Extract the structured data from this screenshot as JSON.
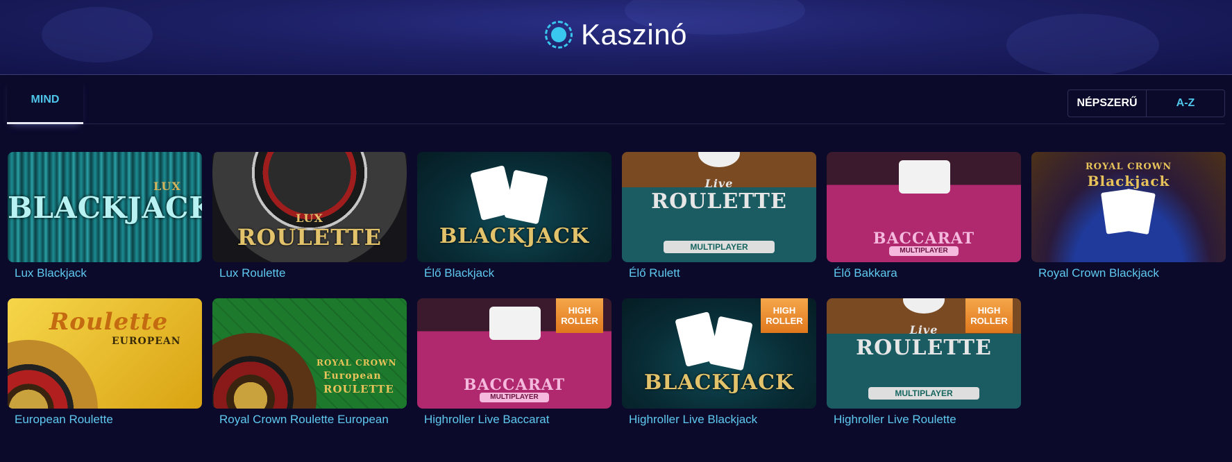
{
  "header": {
    "title": "Kaszinó",
    "icon": "casino-chip-icon"
  },
  "tabs": {
    "all_label": "MIND"
  },
  "sort": {
    "popular_label": "NÉPSZERŰ",
    "az_label": "A-Z"
  },
  "games": [
    {
      "label": "Lux Blackjack",
      "art": "BLACKJACK",
      "art2": "LUX"
    },
    {
      "label": "Lux Roulette",
      "art": "ROULETTE",
      "art2": "LUX"
    },
    {
      "label": "Élő Blackjack",
      "art": "BLACKJACK"
    },
    {
      "label": "Élő Rulett",
      "art": "ROULETTE",
      "art2": "Live",
      "plaque": "MULTIPLAYER"
    },
    {
      "label": "Élő Bakkara",
      "art": "BACCARAT",
      "plaque": "MULTIPLAYER"
    },
    {
      "label": "Royal Crown Blackjack",
      "art": "Blackjack",
      "art2": "ROYAL CROWN"
    },
    {
      "label": "European Roulette",
      "art": "Roulette",
      "art2": "EUROPEAN"
    },
    {
      "label": "Royal Crown Roulette European",
      "art": "ROULETTE",
      "art2": "ROYAL CROWN",
      "art3": "European"
    },
    {
      "label": "Highroller Live Baccarat",
      "art": "BACCARAT",
      "plaque": "MULTIPLAYER",
      "badge1": "HIGH",
      "badge2": "ROLLER"
    },
    {
      "label": "Highroller Live Blackjack",
      "art": "BLACKJACK",
      "badge1": "HIGH",
      "badge2": "ROLLER"
    },
    {
      "label": "Highroller Live Roulette",
      "art": "ROULETTE",
      "art2": "Live",
      "plaque": "MULTIPLAYER",
      "badge1": "HIGH",
      "badge2": "ROLLER"
    }
  ]
}
